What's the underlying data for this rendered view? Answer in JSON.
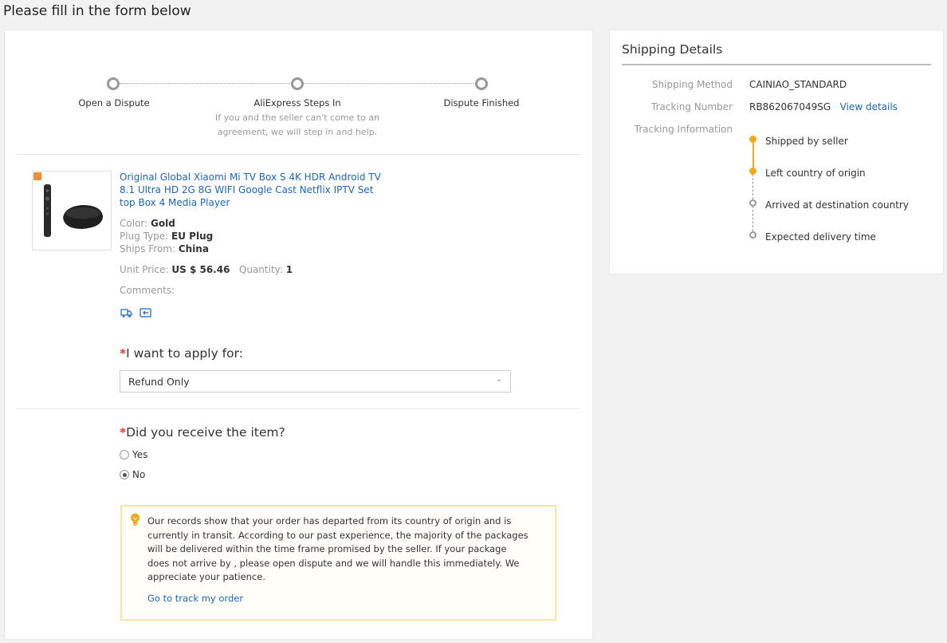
{
  "page": {
    "title": "Please fill in the form below"
  },
  "steps": [
    {
      "label": "Open a Dispute"
    },
    {
      "label": "AliExpress Steps In",
      "desc": "If you and the seller can't come to an agreement, we will step in and help."
    },
    {
      "label": "Dispute Finished"
    }
  ],
  "product": {
    "title": "Original Global Xiaomi Mi TV Box S 4K HDR Android TV 8.1 Ultra HD 2G 8G WIFI Google Cast Netflix IPTV Set top Box 4 Media Player",
    "color_label": "Color:",
    "color_value": "Gold",
    "plug_label": "Plug Type:",
    "plug_value": "EU Plug",
    "ships_label": "Ships From:",
    "ships_value": "China",
    "price_label": "Unit Price:",
    "price_value": "US $ 56.46",
    "qty_label": "Quantity:",
    "qty_value": "1",
    "comments_label": "Comments:"
  },
  "apply": {
    "star": "*",
    "label": "I want to apply for:",
    "selected": "Refund Only"
  },
  "receive": {
    "star": "*",
    "label": "Did you receive the item?",
    "options": [
      {
        "label": "Yes",
        "checked": false
      },
      {
        "label": "No",
        "checked": true
      }
    ]
  },
  "notice": {
    "text": "Our records show that your order has departed from its country of origin and is currently in transit. According to our past experience, the majority of the packages will be delivered within the time frame promised by the seller. If your package does not arrive by , please open dispute and we will handle this immediately. We appreciate your patience.",
    "link": "Go to track my order"
  },
  "shipping": {
    "title": "Shipping Details",
    "method_label": "Shipping Method",
    "method_value": "CAINIAO_STANDARD",
    "tracking_label": "Tracking Number",
    "tracking_value": "RB862067049SG",
    "view_details": "View details",
    "info_label": "Tracking Information",
    "timeline": [
      {
        "label": "Shipped by seller",
        "status": "done"
      },
      {
        "label": "Left country of origin",
        "status": "done"
      },
      {
        "label": "Arrived at destination country",
        "status": "pending"
      },
      {
        "label": "Expected delivery time",
        "status": "pending"
      }
    ]
  },
  "colors": {
    "link": "#1a66c0",
    "accent": "#f5a623",
    "required": "#e4393c"
  }
}
